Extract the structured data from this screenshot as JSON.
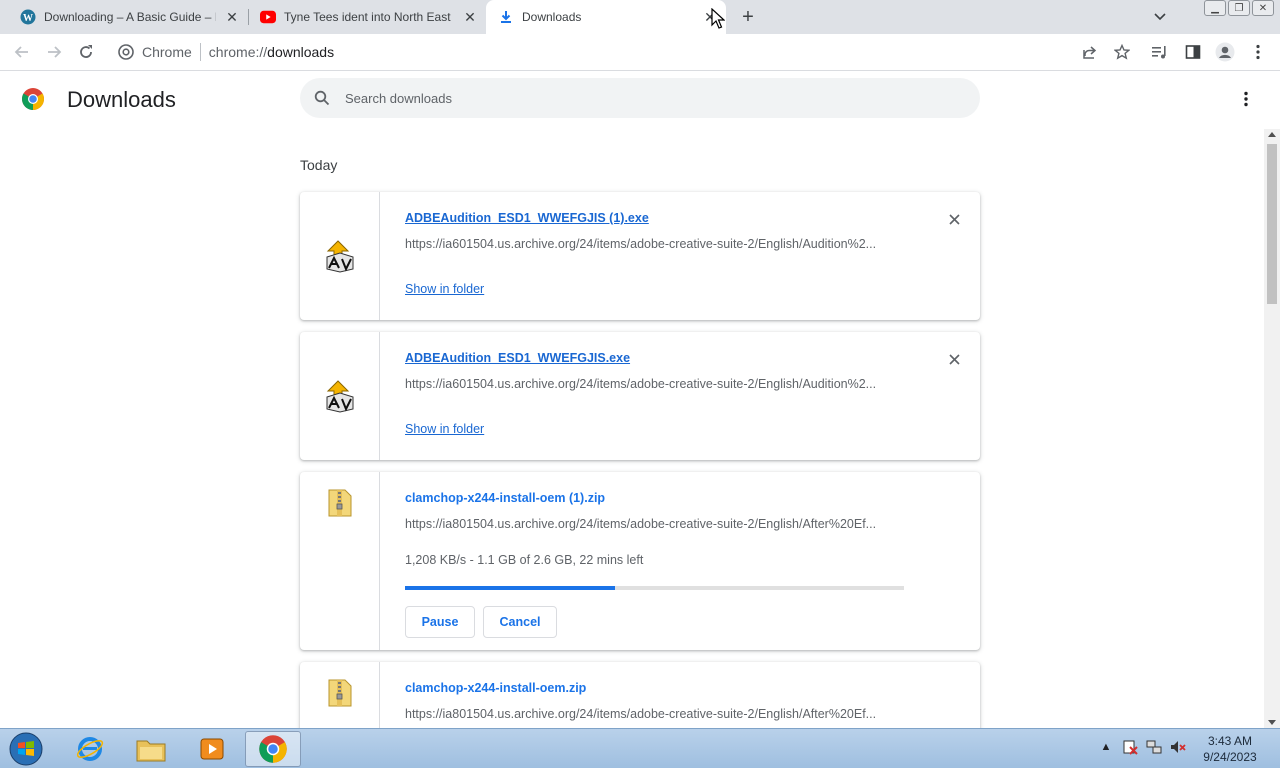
{
  "tabs": [
    {
      "title": "Downloading – A Basic Guide – Int",
      "icon": "wordpress-icon"
    },
    {
      "title": "Tyne Tees ident into North East N",
      "icon": "youtube-icon"
    },
    {
      "title": "Downloads",
      "icon": "download-icon"
    }
  ],
  "omnibox": {
    "site_label": "Chrome",
    "url_scheme": "chrome://",
    "url_host": "downloads"
  },
  "page": {
    "title": "Downloads",
    "search_placeholder": "Search downloads",
    "section": "Today"
  },
  "downloads": [
    {
      "name": "ADBEAudition_ESD1_WWEFGJIS (1).exe",
      "url": "https://ia601504.us.archive.org/24/items/adobe-creative-suite-2/English/Audition%2...",
      "action": "Show in folder",
      "icon": "installer-icon"
    },
    {
      "name": "ADBEAudition_ESD1_WWEFGJIS.exe",
      "url": "https://ia601504.us.archive.org/24/items/adobe-creative-suite-2/English/Audition%2...",
      "action": "Show in folder",
      "icon": "installer-icon"
    },
    {
      "name": "clamchop-x244-install-oem (1).zip",
      "url": "https://ia801504.us.archive.org/24/items/adobe-creative-suite-2/English/After%20Ef...",
      "status": "1,208 KB/s - 1.1 GB of 2.6 GB, 22 mins left",
      "progress_fraction": 0.42,
      "pause_label": "Pause",
      "cancel_label": "Cancel",
      "icon": "zip-folder-icon"
    },
    {
      "name": "clamchop-x244-install-oem.zip",
      "url": "https://ia801504.us.archive.org/24/items/adobe-creative-suite-2/English/After%20Ef...",
      "icon": "zip-folder-icon"
    }
  ],
  "taskbar": {
    "time": "3:43 AM",
    "date": "9/24/2023"
  },
  "colors": {
    "accent": "#1a73e8",
    "tabstrip": "#dee1e6"
  }
}
